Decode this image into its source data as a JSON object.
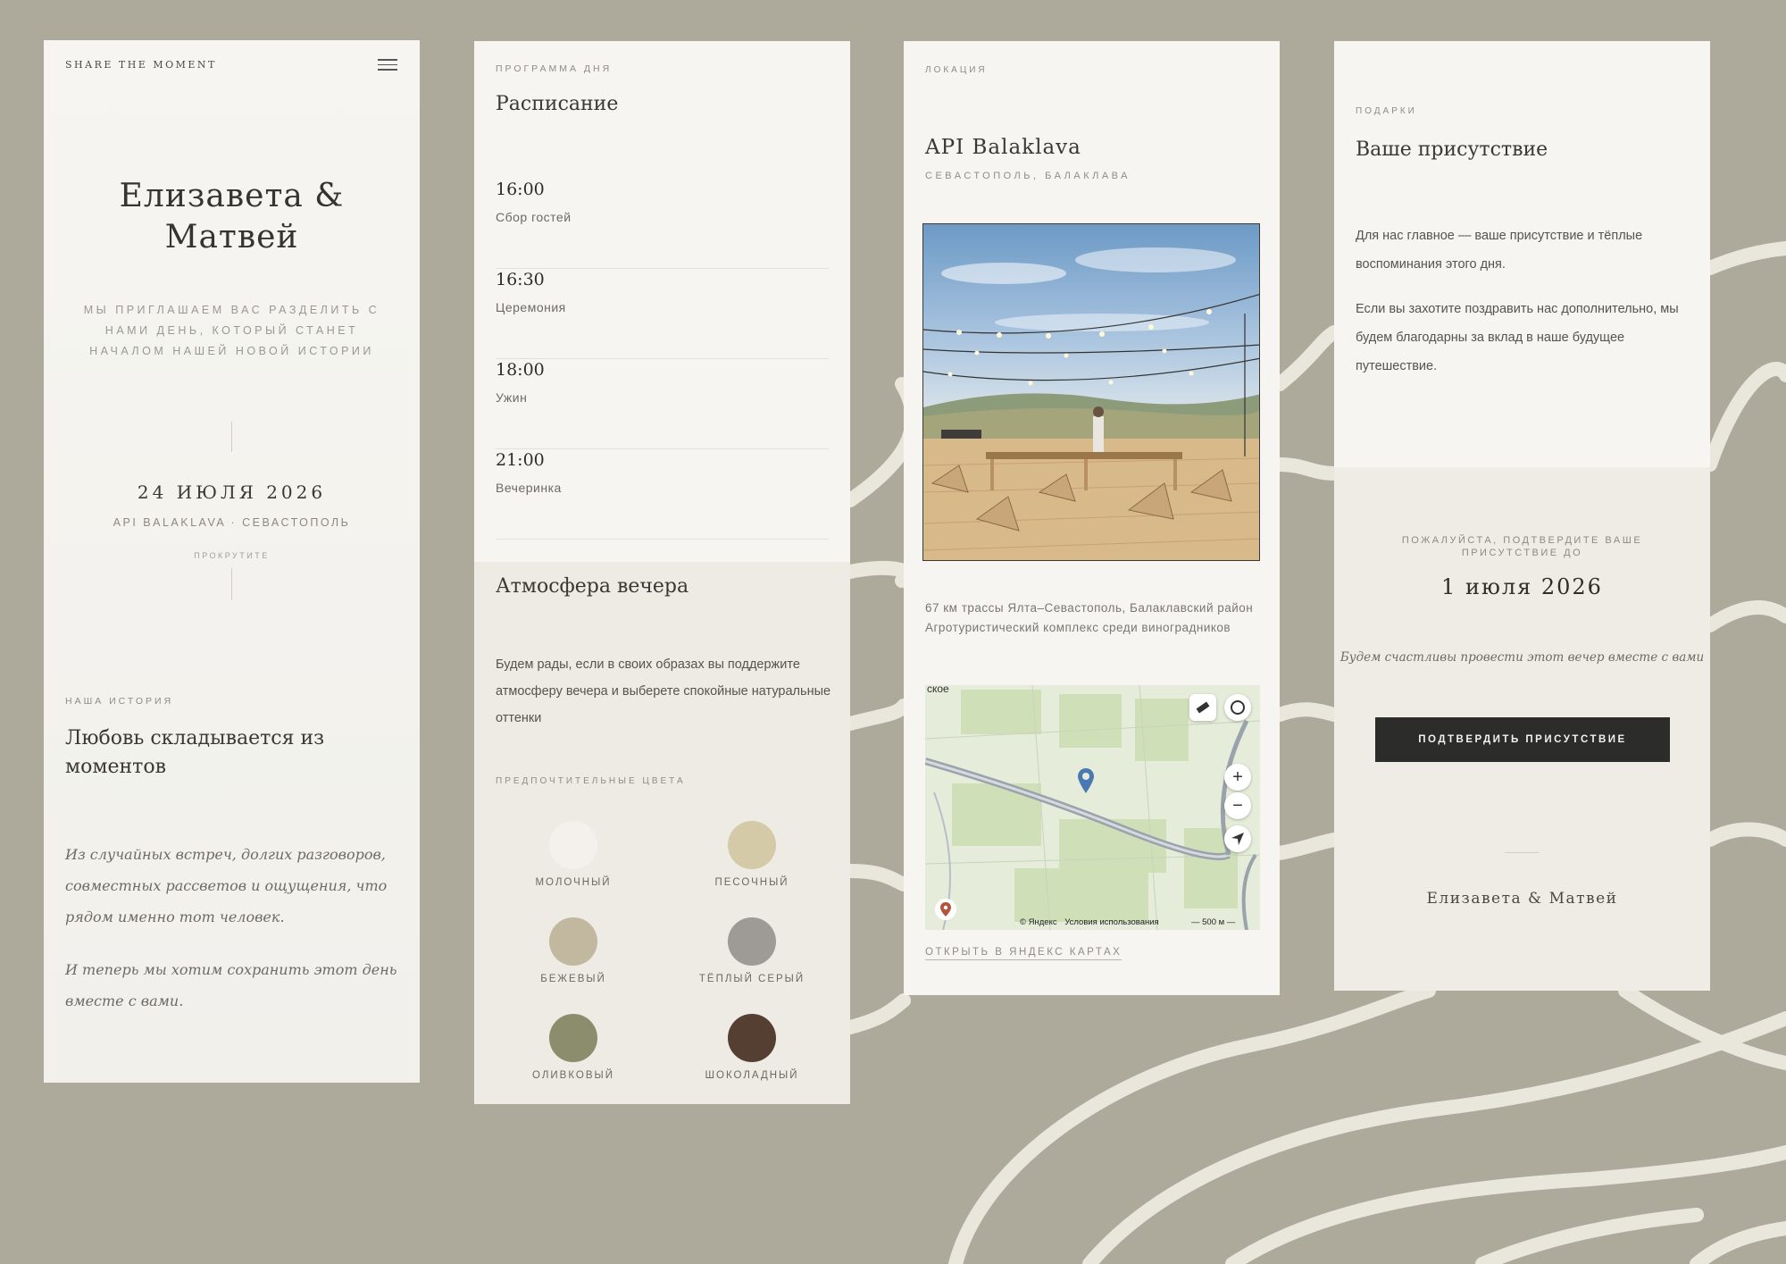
{
  "page1": {
    "brand": "SHARE THE MOMENT",
    "names_line1": "Елизавета &",
    "names_line2": "Матвей",
    "invitation": "МЫ ПРИГЛАШАЕМ ВАС РАЗДЕЛИТЬ С НАМИ ДЕНЬ, КОТОРЫЙ СТАНЕТ НАЧАЛОМ НАШЕЙ НОВОЙ ИСТОРИИ",
    "date": "24 ИЮЛЯ 2026",
    "venue": "API BALAKLAVA · СЕВАСТОПОЛЬ",
    "scroll_hint": "ПРОКРУТИТЕ",
    "story_eyebrow": "НАША ИСТОРИЯ",
    "story_title": "Любовь складывается из моментов",
    "story_p1": "Из случайных встреч, долгих разговоров, совместных рассветов и ощущения, что рядом именно тот человек.",
    "story_p2": "И теперь мы хотим сохранить этот день вместе с вами."
  },
  "page2": {
    "eyebrow": "ПРОГРАММА ДНЯ",
    "title": "Расписание",
    "schedule": [
      {
        "time": "16:00",
        "label": "Сбор гостей"
      },
      {
        "time": "16:30",
        "label": "Церемония"
      },
      {
        "time": "18:00",
        "label": "Ужин"
      },
      {
        "time": "21:00",
        "label": "Вечеринка"
      }
    ],
    "atmosphere_title": "Атмосфера вечера",
    "atmosphere_text": "Будем рады, если в своих образах вы поддержите атмосферу вечера и выберете спокойные натуральные оттенки",
    "colors_eyebrow": "ПРЕДПОЧТИТЕЛЬНЫЕ ЦВЕТА",
    "colors": [
      {
        "name": "МОЛОЧНЫЙ",
        "hex": "#f4f1ec"
      },
      {
        "name": "ПЕСОЧНЫЙ",
        "hex": "#d4caa8"
      },
      {
        "name": "БЕЖЕВЫЙ",
        "hex": "#c2b79f"
      },
      {
        "name": "ТЁПЛЫЙ СЕРЫЙ",
        "hex": "#9e9a95"
      },
      {
        "name": "ОЛИВКОВЫЙ",
        "hex": "#8b8d6d"
      },
      {
        "name": "ШОКОЛАДНЫЙ",
        "hex": "#553f33"
      }
    ]
  },
  "page3": {
    "eyebrow": "ЛОКАЦИЯ",
    "title": "API Balaklava",
    "subtitle": "СЕВАСТОПОЛЬ, БАЛАКЛАВА",
    "address_line1": "67 км трассы Ялта–Севастополь, Балаклавский район",
    "address_line2": "Агротуристический комплекс среди виноградников",
    "map": {
      "place_fragment": "ское",
      "copyright": "© Яндекс",
      "terms": "Условия использования",
      "scale": "500 м",
      "zoom_in": "+",
      "zoom_out": "−"
    },
    "map_link": "ОТКРЫТЬ В ЯНДЕКС КАРТАХ"
  },
  "page4": {
    "eyebrow": "ПОДАРКИ",
    "title": "Ваше присутствие",
    "p1": "Для нас главное — ваше присутствие и тёплые воспоминания этого дня.",
    "p2": "Если вы захотите поздравить нас дополнительно, мы будем благодарны за вклад в наше будущее путешествие.",
    "rsvp_prompt": "ПОЖАЛУЙСТА, ПОДТВЕРДИТЕ ВАШЕ ПРИСУТСТВИЕ ДО",
    "rsvp_date": "1 июля 2026",
    "rsvp_note": "Будем счастливы провести этот вечер вместе с вами",
    "rsvp_button": "ПОДТВЕРДИТЬ ПРИСУТСТВИЕ",
    "signature": "Елизавета & Матвей"
  },
  "colors": {
    "background": "#adaa9c",
    "panel": "#f6f5f1",
    "accent_dark": "#2c2c2b",
    "lines": "#e9e6dc"
  }
}
